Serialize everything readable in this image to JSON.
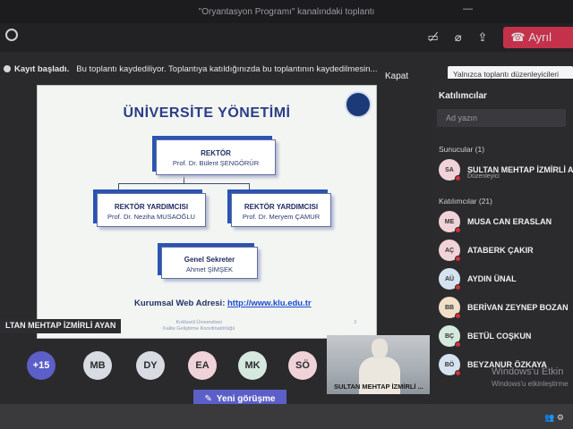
{
  "window": {
    "title": "\"Oryantasyon Programı\" kanalındaki toplantı"
  },
  "recording_banner": {
    "status": "Kayıt başladı.",
    "message": "Bu toplantı kaydediliyor. Toplantıya katıldığınızda bu toplantının kaydedilmesin...",
    "close_label": "Kapat"
  },
  "toolbar": {
    "leave_label": "Ayrıl"
  },
  "tooltip": {
    "text": "Yalnızca toplantı düzenleyicileri ve sunucular paylaşabilir"
  },
  "slide": {
    "title": "ÜNİVERSİTE YÖNETİMİ",
    "rector": {
      "role": "REKTÖR",
      "person": "Prof. Dr. Bülent ŞENGÖRÜR"
    },
    "vice_rector_1": {
      "role": "REKTÖR YARDIMCISI",
      "person": "Prof. Dr. Neziha MUSAOĞLU"
    },
    "vice_rector_2": {
      "role": "REKTÖR YARDIMCISI",
      "person": "Prof. Dr. Meryem ÇAMUR"
    },
    "secretary": {
      "role": "Genel Sekreter",
      "person": "Ahmet ŞİMŞEK"
    },
    "web_label": "Kurumsal Web Adresi:",
    "web_url": "http://www.klu.edu.tr",
    "footer_line1": "Kırklareli Üniversitesi",
    "footer_line2": "Kalite Geliştirme Koordinatörlüğü",
    "page_number": "3"
  },
  "presenter_label": "LTAN MEHTAP İZMİRLİ AYAN",
  "avatars": [
    {
      "initials": "+15",
      "color": "#5b5fc7"
    },
    {
      "initials": "MB",
      "color": "#d9dbe3"
    },
    {
      "initials": "DY",
      "color": "#d9dbe3"
    },
    {
      "initials": "EA",
      "color": "#f0d3d8"
    },
    {
      "initials": "MK",
      "color": "#d5e9de"
    },
    {
      "initials": "SÖ",
      "color": "#f0d3d8"
    }
  ],
  "video_tile": {
    "name": "SULTAN MEHTAP İZMİRLİ ..."
  },
  "new_meeting_label": "Yeni görüşme",
  "panel": {
    "title": "Katılımcılar",
    "search_placeholder": "Ad yazın",
    "presenters_label": "Sunucular (1)",
    "presenter": {
      "initials": "SA",
      "name": "SULTAN MEHTAP İZMİRLİ A...",
      "role": "Düzenleyici",
      "color": "#f0d3d8"
    },
    "attendees_label": "Katılımcılar (21)",
    "attendees": [
      {
        "initials": "ME",
        "name": "MUSA CAN ERASLAN",
        "color": "#f0d3d8"
      },
      {
        "initials": "AÇ",
        "name": "ATABERK ÇAKIR",
        "color": "#f0d3d8"
      },
      {
        "initials": "AÜ",
        "name": "AYDIN ÜNAL",
        "color": "#d5e2ef"
      },
      {
        "initials": "BB",
        "name": "BERİVAN ZEYNEP BOZAN",
        "color": "#f1dfc7"
      },
      {
        "initials": "BÇ",
        "name": "BETÜL COŞKUN",
        "color": "#d5e9de"
      },
      {
        "initials": "BÖ",
        "name": "BEYZANUR ÖZKAYA",
        "color": "#d5e2ef"
      }
    ]
  },
  "watermark": {
    "line1": "Windows'u Etkin",
    "line2": "Windows'u etkinleştirme"
  }
}
